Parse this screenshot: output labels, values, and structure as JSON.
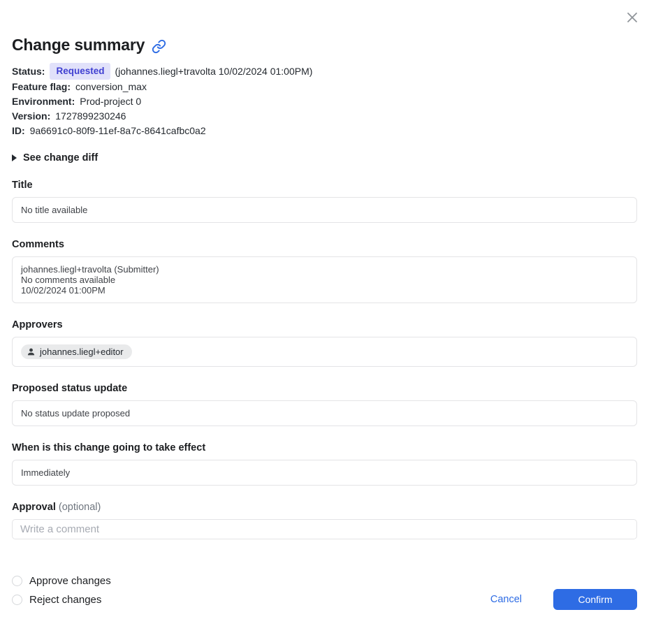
{
  "modal": {
    "title": "Change summary"
  },
  "icons": {
    "close": "x-cross",
    "link": "chain-link",
    "person": "person-silhouette",
    "disclosure": "triangle-right"
  },
  "meta": {
    "status_label": "Status:",
    "status_badge": "Requested",
    "status_suffix": "(johannes.liegl+travolta 10/02/2024 01:00PM)",
    "feature_flag_label": "Feature flag:",
    "feature_flag_value": "conversion_max",
    "environment_label": "Environment:",
    "environment_value": "Prod-project 0",
    "version_label": "Version:",
    "version_value": "1727899230246",
    "id_label": "ID:",
    "id_value": "9a6691c0-80f9-11ef-8a7c-8641cafbc0a2"
  },
  "diff_toggle": {
    "label": "See change diff"
  },
  "sections": {
    "title": {
      "label": "Title",
      "value": "No title available"
    },
    "comments": {
      "label": "Comments",
      "lines": [
        "johannes.liegl+travolta (Submitter)",
        "No comments available",
        "10/02/2024 01:00PM"
      ]
    },
    "approvers": {
      "label": "Approvers",
      "chip": "johannes.liegl+editor"
    },
    "proposed_status": {
      "label": "Proposed status update",
      "value": "No status update proposed"
    },
    "effect": {
      "label": "When is this change going to take effect",
      "value": "Immediately"
    },
    "approval": {
      "label": "Approval",
      "optional": "(optional)",
      "placeholder": "Write a comment",
      "value": ""
    }
  },
  "radios": [
    {
      "label": "Approve changes",
      "checked": false
    },
    {
      "label": "Reject changes",
      "checked": false
    }
  ],
  "footer": {
    "cancel_label": "Cancel",
    "confirm_label": "Confirm"
  },
  "colors": {
    "accent_blue": "#2e6ce4",
    "badge_bg": "#e1e1fa",
    "badge_text": "#3f3fd1",
    "chip_bg": "#e9eaeb",
    "border": "#e4e4e6",
    "close_icon": "#8f9499"
  }
}
